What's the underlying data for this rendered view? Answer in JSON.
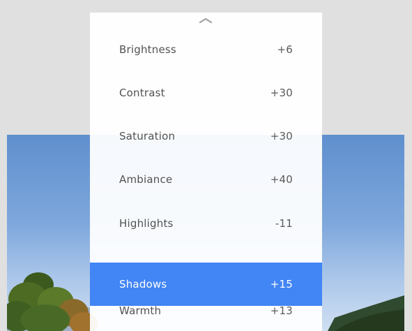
{
  "adjustments": {
    "items": [
      {
        "label": "Brightness",
        "value": "+6"
      },
      {
        "label": "Contrast",
        "value": "+30"
      },
      {
        "label": "Saturation",
        "value": "+30"
      },
      {
        "label": "Ambiance",
        "value": "+40"
      },
      {
        "label": "Highlights",
        "value": "-11"
      },
      {
        "label": "Shadows",
        "value": "+15",
        "selected": true
      },
      {
        "label": "Warmth",
        "value": "+13"
      }
    ]
  },
  "icons": {
    "collapse": "chevron-up-icon"
  },
  "colors": {
    "selected_row": "#4285f4",
    "panel": "#ffffff",
    "background": "#e0e0e0",
    "text": "#525252"
  }
}
